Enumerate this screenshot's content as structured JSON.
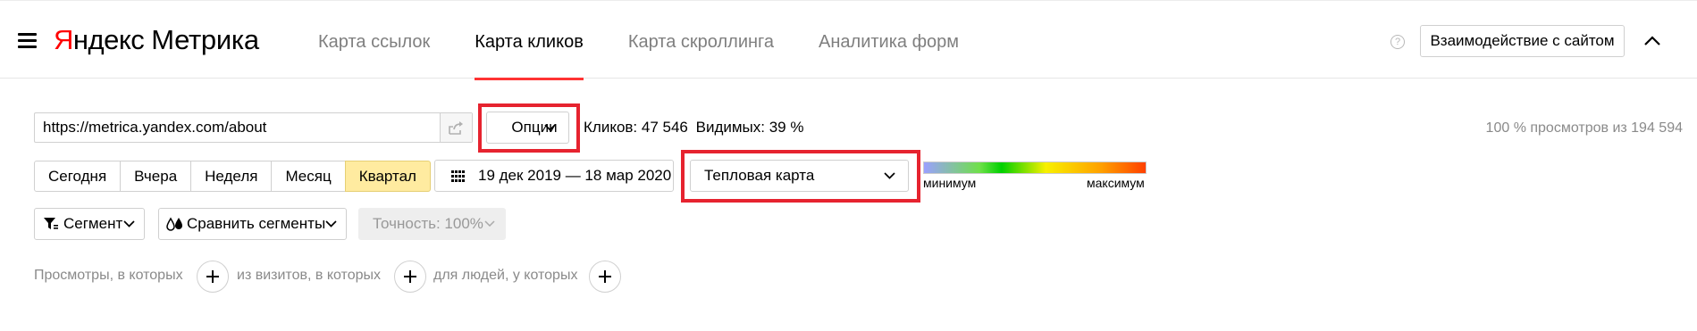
{
  "app": {
    "logo_brand": "Яндекс",
    "logo_product": "Метрика"
  },
  "nav": {
    "tabs": [
      {
        "label": "Карта ссылок",
        "active": false
      },
      {
        "label": "Карта кликов",
        "active": true
      },
      {
        "label": "Карта скроллинга",
        "active": false
      },
      {
        "label": "Аналитика форм",
        "active": false
      }
    ],
    "help_icon": "?",
    "interaction_button": "Взаимодействие с сайтом"
  },
  "toolbar": {
    "url_value": "https://metrica.yandex.com/about",
    "options_label": "Опции",
    "clicks_text": "Кликов: 47 546",
    "visible_text": "Видимых: 39 %",
    "views_total": "100 % просмотров из 194 594"
  },
  "period": {
    "buttons": [
      {
        "label": "Сегодня",
        "active": false
      },
      {
        "label": "Вчера",
        "active": false
      },
      {
        "label": "Неделя",
        "active": false
      },
      {
        "label": "Месяц",
        "active": false
      },
      {
        "label": "Квартал",
        "active": true
      }
    ],
    "date_range": "19 дек 2019 — 18 мар 2020"
  },
  "map_type": {
    "selected": "Тепловая карта"
  },
  "legend": {
    "min_label": "минимум",
    "max_label": "максимум"
  },
  "segments": {
    "segment_label": "Сегмент",
    "compare_label": "Сравнить сегменты",
    "accuracy_label": "Точность: 100%"
  },
  "filters": {
    "views_label": "Просмотры, в которых",
    "visits_label": "из визитов, в которых",
    "people_label": "для людей, у которых"
  },
  "colors": {
    "accent_red": "#f33",
    "highlight_red": "#e6232f",
    "active_period_bg": "#ffeba0"
  }
}
